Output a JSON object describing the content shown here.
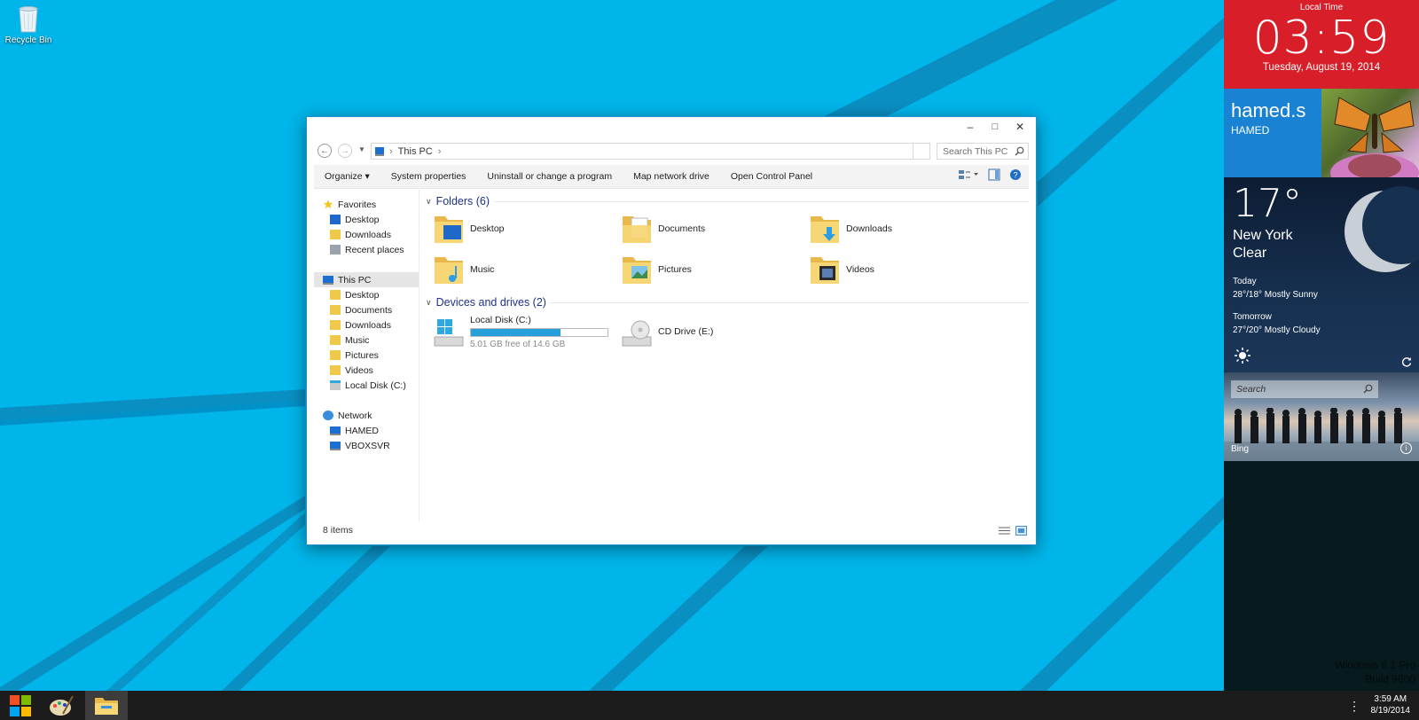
{
  "desktop": {
    "recycle_bin_label": "Recycle Bin"
  },
  "window": {
    "minimize": "–",
    "maximize": "□",
    "close": "✕",
    "breadcrumb": [
      "This PC"
    ],
    "search_placeholder": "Search This PC",
    "toolbar": {
      "organize": "Organize ▾",
      "system_properties": "System properties",
      "uninstall": "Uninstall or change a program",
      "map_drive": "Map network drive",
      "control_panel": "Open Control Panel"
    },
    "nav": {
      "favorites": "Favorites",
      "fav_desktop": "Desktop",
      "fav_downloads": "Downloads",
      "fav_recent": "Recent places",
      "this_pc": "This PC",
      "pc_desktop": "Desktop",
      "pc_documents": "Documents",
      "pc_downloads": "Downloads",
      "pc_music": "Music",
      "pc_pictures": "Pictures",
      "pc_videos": "Videos",
      "pc_local_disk": "Local Disk (C:)",
      "network": "Network",
      "net_hamed": "HAMED",
      "net_vboxsvr": "VBOXSVR"
    },
    "folders_header": "Folders (6)",
    "folders": [
      "Desktop",
      "Documents",
      "Downloads",
      "Music",
      "Pictures",
      "Videos"
    ],
    "devices_header": "Devices and drives (2)",
    "drives": {
      "local_disk_name": "Local Disk (C:)",
      "local_disk_free": "5.01 GB free of 14.6 GB",
      "local_disk_used_fraction": 0.657,
      "cd_drive_name": "CD Drive (E:)"
    },
    "status_text": "8 items"
  },
  "sidebar": {
    "clock_label": "Local Time",
    "time": "03:59",
    "date": "Tuesday, August 19, 2014",
    "user_name": "hamed.s",
    "host_name": "HAMED",
    "weather_temp": "17°",
    "weather_city": "New York",
    "weather_cond": "Clear",
    "today_label": "Today",
    "today_fc": "28°/18° Mostly Sunny",
    "tomorrow_label": "Tomorrow",
    "tomorrow_fc": "27°/20° Mostly Cloudy",
    "bing_search_placeholder": "Search",
    "bing_label": "Bing",
    "watermark_line1": "Windows 8.1 Pro",
    "watermark_line2": "Build 9600"
  },
  "taskbar": {
    "time": "3:59 AM",
    "date": "8/19/2014"
  },
  "colors": {
    "desktop_bg": "#00b7ec",
    "accent_blue": "#26a0da",
    "clock_red": "#d81e28",
    "user_blue": "#1a82d3",
    "taskbar": "#1c1c1c"
  }
}
